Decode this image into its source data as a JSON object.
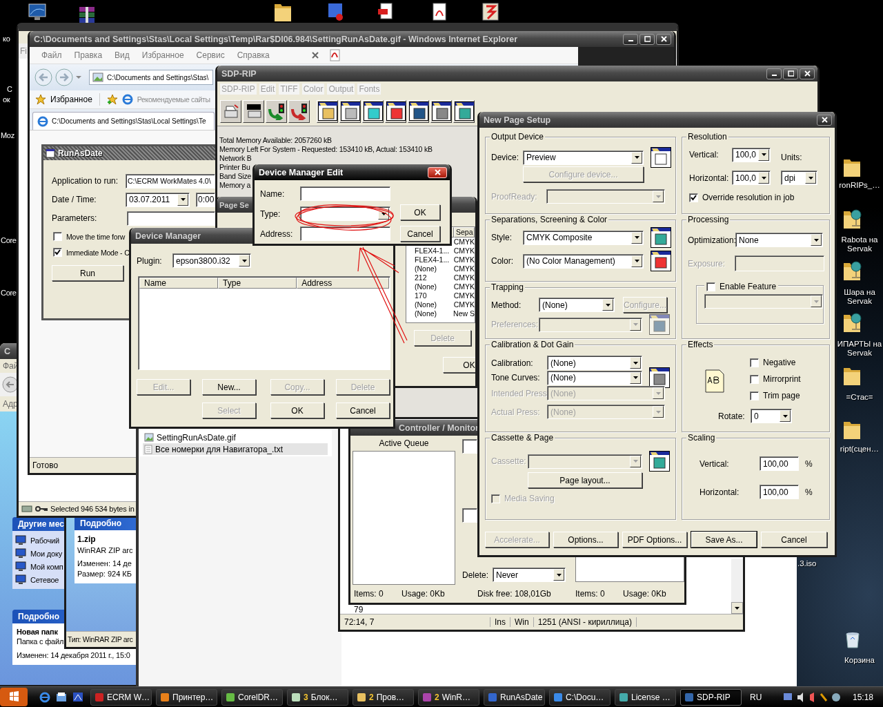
{
  "desktop": {
    "left_labels": [
      "ко",
      "С",
      "ок",
      "Moz",
      "Core",
      "Core"
    ],
    "right_icons": [
      {
        "label": "ronRIPs_…"
      },
      {
        "label": "Rabota на Servak"
      },
      {
        "label": "Шара на Servak"
      },
      {
        "label": "ИПАРТЫ на Servak"
      },
      {
        "label": "=Стас="
      },
      {
        "label": "ript(сцен…"
      },
      {
        "label": ".3.iso"
      },
      {
        "label": "Корзина"
      }
    ]
  },
  "explorer_back": {
    "title": "С",
    "menu": "Фай",
    "address_label": "Адр",
    "other_places": {
      "title": "Другие мес",
      "items": [
        "Рабочий",
        "Мои доку",
        "Мой комп",
        "Сетевое"
      ]
    },
    "details": {
      "title": "Подробно",
      "name": "Новая папк",
      "type": "Папка с файл",
      "modified": "Изменен: 14 декабря 2011 г., 15:0"
    }
  },
  "winrar": {
    "menu": "Fi",
    "status": "Selected 946 534 bytes in"
  },
  "explorer_details": {
    "details": {
      "title": "Подробно",
      "name": "1.zip",
      "type": "WinRAR ZIP arc",
      "modified": "Изменен: 14 де",
      "size": "Размер: 924 КБ"
    },
    "status": "Тип: WinRAR ZIP arc"
  },
  "ie": {
    "title": "C:\\Documents and Settings\\Stas\\Local Settings\\Temp\\Rar$DI06.984\\SettingRunAsDate.gif - Windows Internet Explorer",
    "menu": [
      "Файл",
      "Правка",
      "Вид",
      "Избранное",
      "Сервис",
      "Справка"
    ],
    "address": "C:\\Documents and Settings\\Stas\\",
    "favorites": "Избранное",
    "suggested": "Рекомендуемые сайты",
    "tab": "C:\\Documents and Settings\\Stas\\Local Settings\\Te",
    "status": "Готово",
    "runasdate": {
      "title": "RunAsDate",
      "app_label": "Application to run:",
      "app_value": "C:\\ECRM WorkMates 4.0\\",
      "date_label": "Date / Time:",
      "date": "03.07.2011",
      "time": "0:00",
      "params_label": "Parameters:",
      "options": [
        {
          "label": "Move the time forw",
          "checked": false
        },
        {
          "label": "Immediate Mode - C",
          "checked": true
        }
      ],
      "run": "Run"
    }
  },
  "file_list": {
    "files": [
      {
        "name": "SettingRunAsDate.gif",
        "kind": "image",
        "selected": false
      },
      {
        "name": "Все номерки для Навигатора_.txt",
        "kind": "text",
        "selected": true
      }
    ]
  },
  "notepad": {
    "line": "79",
    "status": [
      "72:14, 7",
      "Ins",
      "Win",
      "1251  (ANSI - кириллица)"
    ]
  },
  "sdp_rip": {
    "title": "SDP-RIP",
    "menu": [
      "SDP-RIP",
      "Edit",
      "TIFF",
      "Color",
      "Output",
      "Fonts"
    ],
    "info": [
      "Total Memory Available: 2057260 kB",
      "Memory Left For System - Requested: 153410 kB, Actual: 153410 kB",
      "Network B",
      "Printer Bu",
      "Band Size",
      "Memory a"
    ]
  },
  "page_setup": {
    "title": "Page Se",
    "column": "Sepa",
    "rows": [
      {
        "column_2": "CMYK"
      },
      {
        "column_1": "FLEX4-1...",
        "column_2": "CMYK"
      },
      {
        "column_1": "FLEX4-1...",
        "column_2": "CMYK"
      },
      {
        "column_1": "(None)",
        "column_2": "CMYK"
      },
      {
        "column_1": "212",
        "column_2": "CMYK"
      },
      {
        "column_1": "(None)",
        "column_2": "CMYK"
      },
      {
        "column_1": "170",
        "column_2": "CMYK"
      },
      {
        "column_1": "(None)",
        "column_2": "CMYK"
      },
      {
        "column_1": "(None)",
        "column_2": "New S"
      }
    ],
    "buttons": [
      {
        "label": "Delete",
        "disabled": true
      },
      {
        "label": "OK",
        "disabled": false
      }
    ]
  },
  "spooler": {
    "title": "Controller / Monitor",
    "active_queue": "Active Queue",
    "delete_label": "Delete:",
    "delete_value": "Never",
    "footer": [
      "Items: 0",
      "Usage: 0Kb",
      "Disk free: 108,01Gb",
      "Items: 0",
      "Usage: 0Kb"
    ]
  },
  "new_page_setup": {
    "title": "New Page Setup",
    "output_device": {
      "title": "Output Device",
      "device_label": "Device:",
      "device": "Preview",
      "configure": {
        "label": "Configure device...",
        "disabled": true
      },
      "proofready": {
        "label": "ProofReady:",
        "disabled": true
      }
    },
    "separations": {
      "title": "Separations, Screening & Color",
      "style_label": "Style:",
      "style": "CMYK Composite",
      "profile_label": "Color:",
      "profile": "(No Color Management)"
    },
    "trapping": {
      "title": "Trapping",
      "method_label": "Method:",
      "method": "(None)",
      "configure": {
        "label": "Configure...",
        "disabled": true
      },
      "preferences": {
        "label": "Preferences:",
        "disabled": true
      }
    },
    "calibration": {
      "title": "Calibration & Dot Gain",
      "calibration_label": "Calibration:",
      "calibration": "(None)",
      "tone_label": "Tone Curves:",
      "tone": "(None)",
      "intended": {
        "label": "Intended Press:",
        "value": "(None)",
        "disabled": true
      },
      "actual": {
        "label": "Actual Press:",
        "value": "(None)",
        "disabled": true
      }
    },
    "cassette": {
      "title": "Cassette & Page",
      "cassette": {
        "label": "Cassette:",
        "disabled": true
      },
      "page_layout": "Page layout...",
      "media_saving": {
        "label": "Media Saving",
        "checked": false,
        "disabled": true
      }
    },
    "resolution": {
      "title": "Resolution",
      "vertical_label": "Vertical:",
      "vertical": "100,0",
      "units_label": "Units:",
      "horizontal_label": "Horizontal:",
      "horizontal": "100,0",
      "units": "dpi",
      "override": {
        "label": "Override resolution in job",
        "checked": true
      }
    },
    "processing": {
      "title": "Processing",
      "optimization_label": "Optimization:",
      "optimization": "None",
      "exposure": {
        "label": "Exposure:",
        "disabled": true
      },
      "enable_feature": {
        "label": "Enable Feature",
        "checked": false
      }
    },
    "effects": {
      "title": "Effects",
      "options": [
        {
          "label": "Negative",
          "checked": false
        },
        {
          "label": "Mirrorprint",
          "checked": false
        },
        {
          "label": "Trim page",
          "checked": false
        }
      ],
      "rotate_label": "Rotate:",
      "rotate": "0"
    },
    "scaling": {
      "title": "Scaling",
      "vertical_label": "Vertical:",
      "vertical": "100,00",
      "vertical_unit": "%",
      "horizontal_label": "Horizontal:",
      "horizontal": "100,00",
      "horizontal_unit": "%"
    },
    "buttons": [
      {
        "label": "Accelerate...",
        "disabled": true,
        "default": false
      },
      {
        "label": "Options...",
        "disabled": false,
        "default": false
      },
      {
        "label": "PDF Options...",
        "disabled": false,
        "default": false
      },
      {
        "label": "Save As...",
        "disabled": false,
        "default": true
      },
      {
        "label": "Cancel",
        "disabled": false,
        "default": false
      }
    ]
  },
  "device_manager": {
    "title": "Device Manager",
    "plugin_label": "Plugin:",
    "plugin": "epson3800.i32",
    "columns": [
      "Name",
      "Type",
      "Address"
    ],
    "buttons": [
      {
        "label": "Edit...",
        "disabled": true
      },
      {
        "label": "New...",
        "disabled": false
      },
      {
        "label": "Copy...",
        "disabled": true
      },
      {
        "label": "Delete",
        "disabled": true
      },
      {
        "label": "Select",
        "disabled": true
      },
      {
        "label": "OK",
        "disabled": false
      },
      {
        "label": "Cancel",
        "disabled": false
      }
    ]
  },
  "device_manager_edit": {
    "title": "Device Manager Edit",
    "fields": [
      {
        "label": "Name:",
        "kind": "text"
      },
      {
        "label": "Type:",
        "kind": "combo"
      },
      {
        "label": "Address:",
        "kind": "text"
      }
    ],
    "buttons": [
      "OK",
      "Cancel"
    ]
  },
  "taskbar": {
    "buttons": [
      {
        "label": "ECRM W…",
        "selected": false
      },
      {
        "label": "Принтер…",
        "selected": false
      },
      {
        "label": "CorelDR…",
        "selected": false
      },
      {
        "count": "3",
        "label": "Блок…",
        "selected": false
      },
      {
        "count": "2",
        "label": "Пров…",
        "selected": false
      },
      {
        "count": "2",
        "label": "WinR…",
        "selected": false
      },
      {
        "label": "RunAsDate",
        "selected": false
      },
      {
        "label": "C:\\Docu…",
        "selected": false
      },
      {
        "label": "License …",
        "selected": false
      },
      {
        "label": "SDP-RIP",
        "selected": true
      }
    ],
    "language": "RU",
    "clock": "15:18"
  }
}
